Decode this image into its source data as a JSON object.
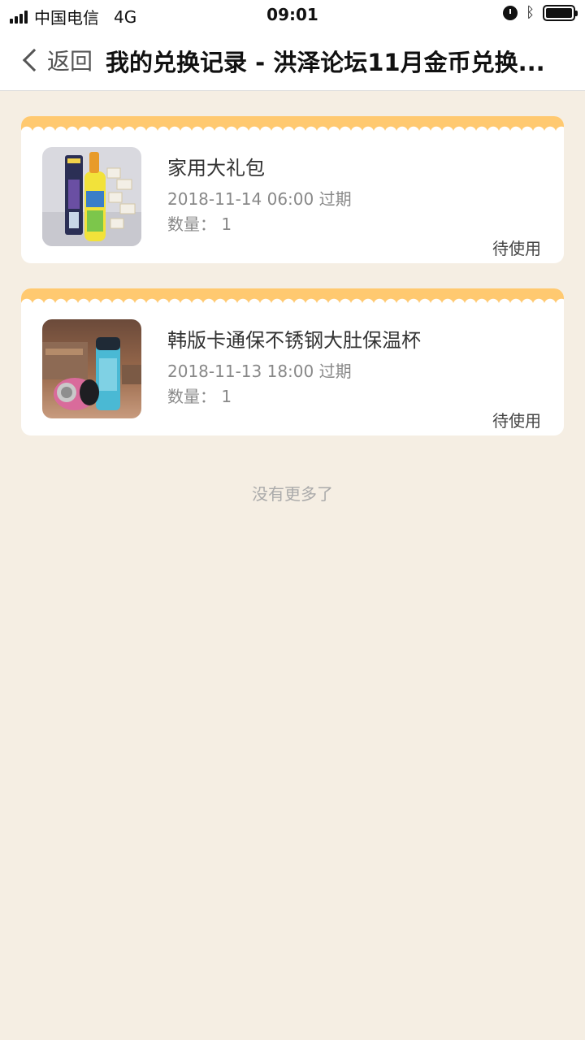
{
  "status_bar": {
    "carrier": "中国电信",
    "network": "4G",
    "time": "09:01",
    "icons": [
      "signal-icon",
      "alarm-icon",
      "bluetooth-icon",
      "battery-icon"
    ]
  },
  "nav": {
    "back_label": "返回",
    "title": "我的兑换记录 - 洪泽论坛11月金币兑换..."
  },
  "records": [
    {
      "name": "家用大礼包",
      "expiry": "2018-11-14 06:00 过期",
      "quantity": "数量： 1",
      "status": "待使用"
    },
    {
      "name": "韩版卡通保不锈钢大肚保温杯",
      "expiry": "2018-11-13 18:00 过期",
      "quantity": "数量： 1",
      "status": "待使用"
    }
  ],
  "footer": {
    "no_more": "没有更多了"
  },
  "colors": {
    "background": "#f5eee3",
    "card_top_accent": "#ffc970"
  }
}
